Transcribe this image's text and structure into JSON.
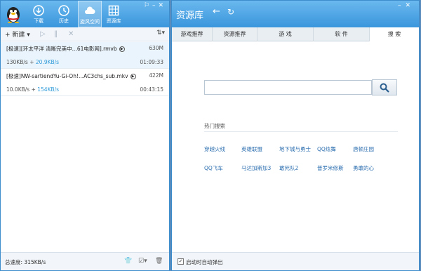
{
  "left": {
    "nav": [
      {
        "label": "下载",
        "icon": "download-icon"
      },
      {
        "label": "历史",
        "icon": "history-icon"
      },
      {
        "label": "旋风空间",
        "icon": "cloud-icon"
      },
      {
        "label": "资源库",
        "icon": "grid-icon"
      }
    ],
    "toolbar": {
      "new_label": "+ 新建",
      "dropdown": "▾",
      "sort": "⇅▾"
    },
    "tasks": [
      {
        "name": "[极速][环太平洋 清晰完美中...61电影网].rmvb",
        "size": "630M",
        "down": "130KB/s",
        "up": "20.9KB/s",
        "time": "01:09:33"
      },
      {
        "name": "[极速]NW-sartiendYu-Gi-Oh!...AC3chs_sub.mkv",
        "size": "422M",
        "down": "10.0KB/s",
        "up": "154KB/s",
        "time": "00:43:15"
      }
    ],
    "footer": {
      "total": "总速度: 315KB/s"
    }
  },
  "right": {
    "title": "资源库",
    "tabs": [
      "游戏推荐",
      "资源推荐",
      "游 戏",
      "软 件",
      "搜 索"
    ],
    "active_tab": 4,
    "search": {
      "placeholder": "",
      "value": ""
    },
    "hot": {
      "title": "热门搜索",
      "row1": [
        "穿越火线",
        "英雄联盟",
        "地下城与勇士",
        "QQ炫舞",
        "唐顿庄园"
      ],
      "row2": [
        "QQ飞车",
        "马达加斯加3",
        "敢死队2",
        "普罗米修斯",
        "勇敢的心"
      ]
    },
    "footer": {
      "checkbox_label": "启动时自动弹出",
      "checked": true
    }
  }
}
